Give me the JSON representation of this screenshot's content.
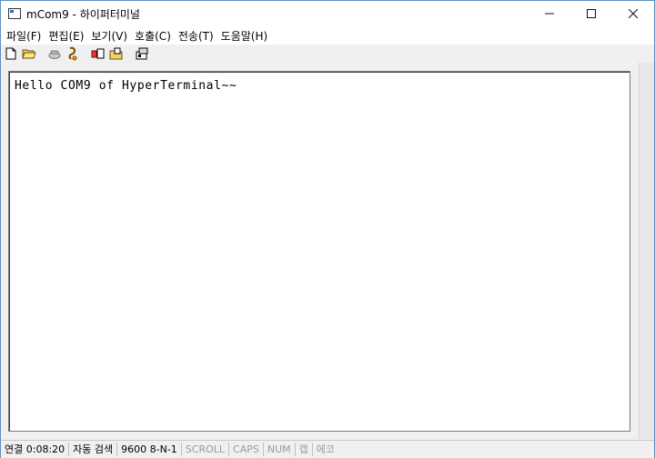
{
  "window": {
    "title": "mCom9 - 하이퍼터미널",
    "controls": {
      "minimize": "—",
      "maximize": "☐",
      "close": "✕"
    }
  },
  "menu": [
    "파일(F)",
    "편집(E)",
    "보기(V)",
    "호출(C)",
    "전송(T)",
    "도움말(H)"
  ],
  "toolbar": {
    "icons": [
      "new-file-icon",
      "open-folder-icon",
      "call-icon",
      "disconnect-icon",
      "send-icon",
      "receive-icon",
      "properties-icon"
    ]
  },
  "terminal": {
    "text": "Hello COM9 of HyperTerminal~~"
  },
  "status": {
    "connection": "연결 0:08:20",
    "detect": "자동 검색",
    "settings": "9600 8-N-1",
    "scroll": "SCROLL",
    "caps": "CAPS",
    "num": "NUM",
    "capture": "캡",
    "echo": "에코"
  }
}
